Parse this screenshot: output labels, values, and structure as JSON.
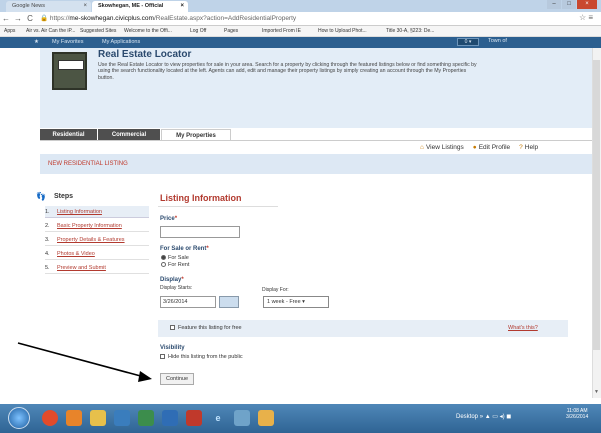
{
  "browser": {
    "tabs": [
      {
        "label": "Google News",
        "active": false
      },
      {
        "label": "Skowhegan, ME - Official",
        "active": true
      }
    ],
    "address": {
      "scheme": "https://",
      "host": "me-skowhegan.civicplus.com",
      "path": "/RealEstate.aspx?action=AddResidentialProperty"
    },
    "bookmarks": [
      "Apps",
      "Air vs. Air Can the iP...",
      "Suggested Sites",
      "Welcome to the Offi...",
      "Log Off",
      "Pages",
      "Imported From IE",
      "How to Upload Phot...",
      "Title 30-A, §223: De..."
    ]
  },
  "site_nav": {
    "favorites": "My Favorites",
    "applications": "My Applications",
    "town": "Town of"
  },
  "banner": {
    "title": "Real Estate Locator",
    "text": "Use the Real Estate Locator to view properties for sale in your area. Search for a property by clicking through the featured listings below or find something specific by using the search functionality located at the left. Agents can add, edit and manage their property listings by simply creating an account through the My Properties button."
  },
  "tabs": [
    "Residential",
    "Commercial",
    "My Properties"
  ],
  "actions": {
    "view": "View Listings",
    "edit": "Edit Profile",
    "help": "Help"
  },
  "page_header": "NEW RESIDENTIAL LISTING",
  "steps": {
    "title": "Steps",
    "items": [
      {
        "num": "1.",
        "label": "Listing Information"
      },
      {
        "num": "2.",
        "label": "Basic Property Information"
      },
      {
        "num": "3.",
        "label": "Property Details & Features"
      },
      {
        "num": "4.",
        "label": "Photos & Video"
      },
      {
        "num": "5.",
        "label": "Preview and Submit"
      }
    ]
  },
  "form": {
    "title": "Listing Information",
    "price_label": "Price",
    "req": "*",
    "sale_label": "For Sale or Rent",
    "sale_options": [
      "For Sale",
      "For Rent"
    ],
    "display_label": "Display",
    "starts_label": "Display Starts:",
    "start_value": "3/26/2014",
    "for_label": "Display For:",
    "for_value": "1 week - Free",
    "feature_label": "Feature this listing for free",
    "whats_this": "What's this?",
    "visibility_label": "Visibility",
    "hide_label": "Hide this listing from the public",
    "continue": "Continue"
  },
  "taskbar": {
    "desktop": "Desktop",
    "time": "11:08 AM",
    "date": "3/26/2014"
  }
}
